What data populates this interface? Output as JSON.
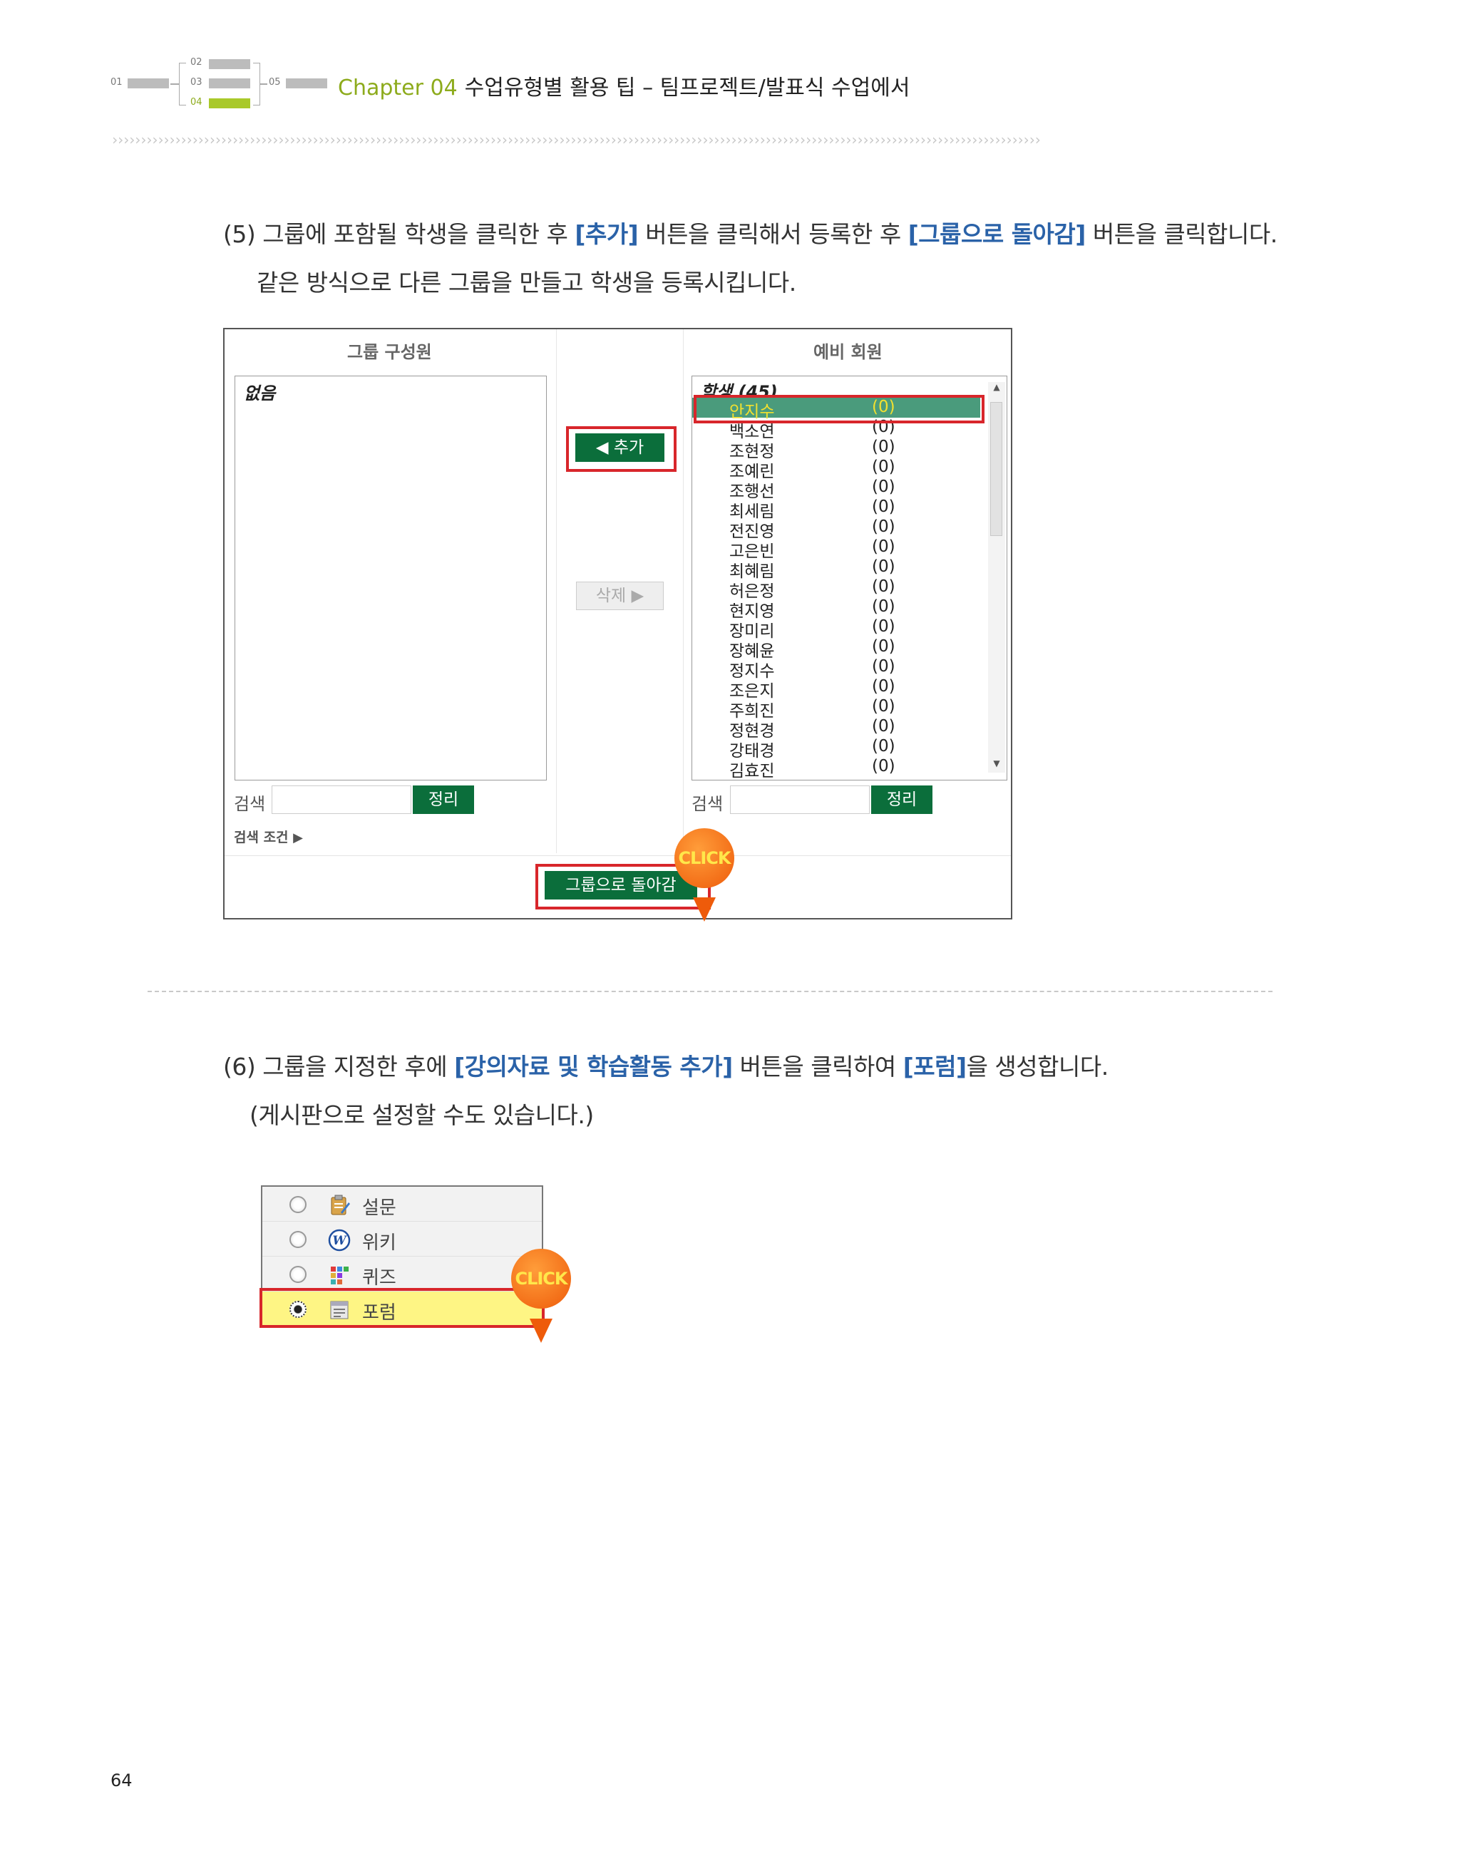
{
  "header": {
    "nav_steps": [
      "01",
      "02",
      "03",
      "04",
      "05"
    ],
    "active_step": "04",
    "chapter_label": "Chapter 04",
    "chapter_title": "수업유형별 활용 팁 – 팀프로젝트/발표식 수업에서",
    "dots": "››››››››››››››››››››››››››››››››››››››››››››››››››››››››››››››››››››››››››››››››››››››››››››››››››››››››››››››››››››››››››››››››››››››››››››››››››››››››››››››››››"
  },
  "step5": {
    "prefix": "(5) 그룹에 포함될 학생을 클릭한 후 ",
    "hl1": "[추가]",
    "mid": " 버튼을 클릭해서 등록한 후 ",
    "hl2": "[그룹으로 돌아감]",
    "suffix": " 버튼을 클릭합니다.",
    "line2": "같은 방식으로 다른 그룹을 만들고 학생을 등록시킵니다."
  },
  "screen1": {
    "left_title": "그룹 구성원",
    "right_title": "예비 회원",
    "left_empty": "없음",
    "group_label": "학생 (45)",
    "add_button": "◀ 추가",
    "delete_button": "삭제 ▶",
    "search_label": "검색",
    "sort_button": "정리",
    "search_condition": "검색 조건",
    "back_button": "그룹으로 돌아감",
    "click_label": "CLICK",
    "members": [
      {
        "name": "안지수",
        "count": "(0)"
      },
      {
        "name": "백소연",
        "count": "(0)"
      },
      {
        "name": "조현정",
        "count": "(0)"
      },
      {
        "name": "조예린",
        "count": "(0)"
      },
      {
        "name": "조행선",
        "count": "(0)"
      },
      {
        "name": "최세림",
        "count": "(0)"
      },
      {
        "name": "전진영",
        "count": "(0)"
      },
      {
        "name": "고은빈",
        "count": "(0)"
      },
      {
        "name": "최혜림",
        "count": "(0)"
      },
      {
        "name": "허은정",
        "count": "(0)"
      },
      {
        "name": "현지영",
        "count": "(0)"
      },
      {
        "name": "장미리",
        "count": "(0)"
      },
      {
        "name": "장혜윤",
        "count": "(0)"
      },
      {
        "name": "정지수",
        "count": "(0)"
      },
      {
        "name": "조은지",
        "count": "(0)"
      },
      {
        "name": "주희진",
        "count": "(0)"
      },
      {
        "name": "정현경",
        "count": "(0)"
      },
      {
        "name": "강태경",
        "count": "(0)"
      },
      {
        "name": "김효진",
        "count": "(0)"
      }
    ]
  },
  "step6": {
    "prefix": "(6) 그룹을 지정한 후에 ",
    "hl1": "[강의자료 및 학습활동 추가]",
    "mid": " 버튼을 클릭하여 ",
    "hl2": "[포럼]",
    "suffix": "을 생성합니다.",
    "line2": "(게시판으로 설정할 수도 있습니다.)"
  },
  "screen2": {
    "options": [
      "설문",
      "위키",
      "퀴즈",
      "포럼"
    ],
    "selected": "포럼",
    "click_label": "CLICK"
  },
  "page_number": "64",
  "colors": {
    "accent_green": "#a9c92a",
    "highlight_blue": "#2a62a8",
    "button_green": "#0b6e3b",
    "callout_red": "#d8262b",
    "click_orange": "#ee5b0a"
  }
}
